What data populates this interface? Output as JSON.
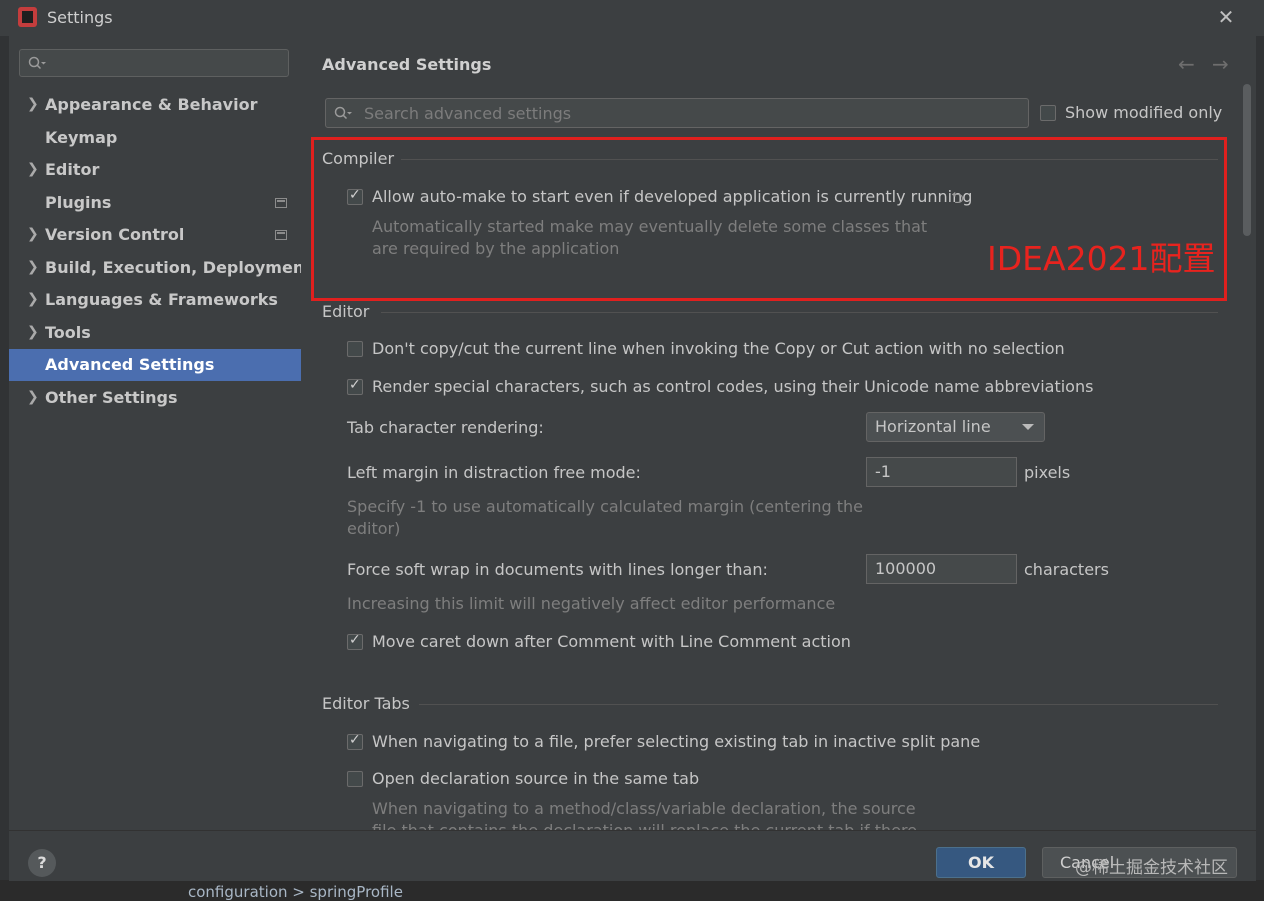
{
  "window": {
    "title": "Settings",
    "breadcrumbs": "configuration  >  springProfile"
  },
  "sidebar": {
    "search_placeholder": "",
    "items": [
      {
        "label": "Appearance & Behavior",
        "expandable": true
      },
      {
        "label": "Keymap",
        "expandable": false
      },
      {
        "label": "Editor",
        "expandable": true
      },
      {
        "label": "Plugins",
        "expandable": false,
        "badge": true
      },
      {
        "label": "Version Control",
        "expandable": true,
        "badge": true
      },
      {
        "label": "Build, Execution, Deployment",
        "expandable": true
      },
      {
        "label": "Languages & Frameworks",
        "expandable": true
      },
      {
        "label": "Tools",
        "expandable": true
      },
      {
        "label": "Advanced Settings",
        "expandable": false,
        "selected": true
      },
      {
        "label": "Other Settings",
        "expandable": true
      }
    ]
  },
  "main": {
    "heading": "Advanced Settings",
    "search_placeholder": "Search advanced settings",
    "show_modified_label": "Show modified only",
    "annotation": "IDEA2021配置",
    "compiler": {
      "title": "Compiler",
      "auto_make_label": "Allow auto-make to start even if developed application is currently running",
      "auto_make_checked": true,
      "auto_make_desc_1": "Automatically started make may eventually delete some classes that",
      "auto_make_desc_2": "are required by the application"
    },
    "editor": {
      "title": "Editor",
      "dont_copy_label": "Don't copy/cut the current line when invoking the Copy or Cut action with no selection",
      "render_special_label": "Render special characters, such as control codes, using their Unicode name abbreviations",
      "tab_rendering_label": "Tab character rendering:",
      "tab_rendering_value": "Horizontal line",
      "left_margin_label": "Left margin in distraction free mode:",
      "left_margin_value": "-1",
      "left_margin_unit": "pixels",
      "left_margin_desc_1": "Specify -1 to use automatically calculated margin (centering the",
      "left_margin_desc_2": "editor)",
      "soft_wrap_label": "Force soft wrap in documents with lines longer than:",
      "soft_wrap_value": "100000",
      "soft_wrap_unit": "characters",
      "soft_wrap_desc": "Increasing this limit will negatively affect editor performance",
      "move_caret_label": "Move caret down after Comment with Line Comment action"
    },
    "editor_tabs": {
      "title": "Editor Tabs",
      "prefer_existing_label": "When navigating to a file, prefer selecting existing tab in inactive split pane",
      "open_same_tab_label": "Open declaration source in the same tab",
      "open_same_tab_desc_1": "When navigating to a method/class/variable declaration, the source",
      "open_same_tab_desc_2": "file that contains the declaration will replace the current tab if there"
    }
  },
  "footer": {
    "help_label": "?",
    "ok_label": "OK",
    "cancel_label": "Cancel",
    "watermark": "@稀土掘金技术社区"
  },
  "colors": {
    "accent": "#4b6eaf",
    "annotation": "#e0201e",
    "ok_button": "#365880"
  }
}
